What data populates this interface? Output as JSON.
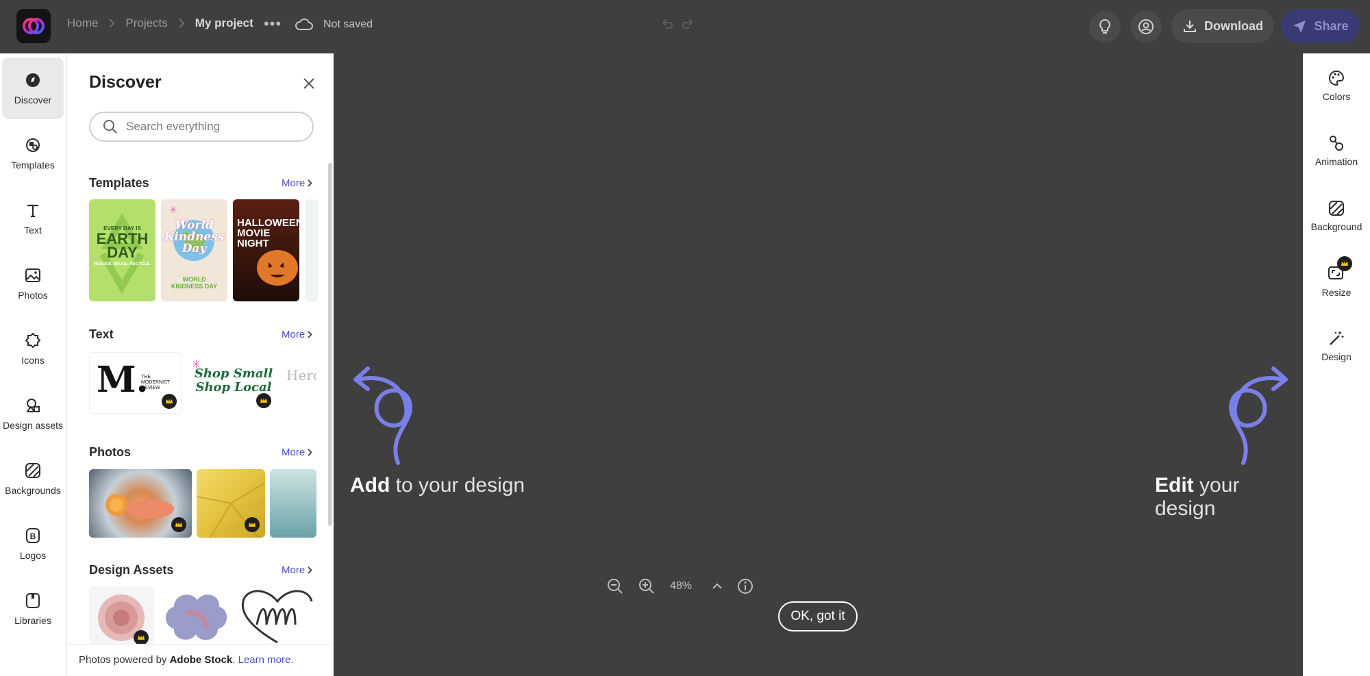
{
  "breadcrumb": [
    "Home",
    "Projects",
    "My project"
  ],
  "save_status": "Not saved",
  "header": {
    "download_label": "Download",
    "share_label": "Share"
  },
  "left_rail": [
    {
      "label": "Discover",
      "icon": "compass-icon",
      "active": true
    },
    {
      "label": "Templates",
      "icon": "templates-icon"
    },
    {
      "label": "Text",
      "icon": "text-icon"
    },
    {
      "label": "Photos",
      "icon": "photo-icon"
    },
    {
      "label": "Icons",
      "icon": "shape-icon"
    },
    {
      "label": "Design assets",
      "icon": "design-assets-icon"
    },
    {
      "label": "Backgrounds",
      "icon": "backgrounds-icon"
    },
    {
      "label": "Logos",
      "icon": "logo-icon"
    },
    {
      "label": "Libraries",
      "icon": "library-icon"
    }
  ],
  "panel": {
    "title": "Discover",
    "search_placeholder": "Search everything",
    "more_label": "More",
    "sections": {
      "templates": "Templates",
      "text": "Text",
      "photos": "Photos",
      "design_assets": "Design Assets"
    },
    "templates": [
      {
        "top": "EVERY DAY IS",
        "main": "EARTH DAY",
        "sub": "REDUCE. REUSE. RECYCLE."
      },
      {
        "main": "World Kindness Day",
        "sub": "WORLD KINDNESS DAY"
      },
      {
        "main": "HALLOWEEN MOVIE NIGHT"
      }
    ],
    "text_items": [
      {
        "big": "M.",
        "small": "THE MODERNIST REVIEW"
      },
      {
        "main": "Shop Small Shop Local"
      },
      {
        "main": "Hero"
      }
    ],
    "footer": {
      "prefix": "Photos powered by ",
      "brand": "Adobe Stock",
      "dot": ".",
      "link": "Learn more."
    }
  },
  "canvas": {
    "add_bold": "Add",
    "add_rest": " to your design",
    "edit_bold": "Edit",
    "edit_rest": " your design",
    "zoom": "48%",
    "ok_label": "OK, got it"
  },
  "right_rail": [
    {
      "label": "Colors",
      "icon": "palette-icon"
    },
    {
      "label": "Animation",
      "icon": "animation-icon"
    },
    {
      "label": "Background",
      "icon": "background-icon"
    },
    {
      "label": "Resize",
      "icon": "resize-icon",
      "premium": true
    },
    {
      "label": "Design",
      "icon": "magic-wand-icon"
    }
  ],
  "colors": {
    "accent": "#4e4fc0",
    "arrow": "#7b7fe8",
    "canvas": "#3f3f3f"
  }
}
